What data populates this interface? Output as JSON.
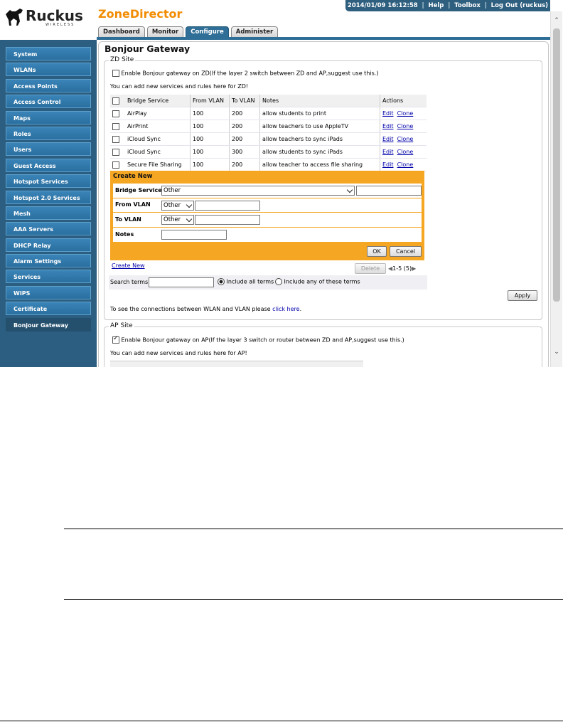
{
  "header": {
    "brand": "Ruckus",
    "brand_sub": "WIRELESS",
    "app_title": "ZoneDirector",
    "datetime": "2014/01/09  16:12:58",
    "links": [
      "Help",
      "Toolbox",
      "Log Out (ruckus)"
    ]
  },
  "tabs": [
    "Dashboard",
    "Monitor",
    "Configure",
    "Administer"
  ],
  "active_tab": "Configure",
  "sidebar": {
    "items": [
      "System",
      "WLANs",
      "Access Points",
      "Access Control",
      "Maps",
      "Roles",
      "Users",
      "Guest Access",
      "Hotspot Services",
      "Hotspot 2.0 Services",
      "Mesh",
      "AAA Servers",
      "DHCP Relay",
      "Alarm Settings",
      "Services",
      "WIPS",
      "Certificate",
      "Bonjour Gateway"
    ],
    "active": "Bonjour Gateway"
  },
  "page_title": "Bonjour Gateway",
  "zd_site": {
    "legend": "ZD Site",
    "enable_label": "Enable Bonjour gateway on ZD(If the layer 2 switch between ZD and AP,suggest use this.)",
    "enabled": false,
    "hint": "You can add new services and rules here for ZD!",
    "columns": [
      "Bridge Service",
      "From VLAN",
      "To VLAN",
      "Notes",
      "Actions"
    ],
    "rows": [
      {
        "service": "AirPlay",
        "from": "100",
        "to": "200",
        "notes": "allow students to print"
      },
      {
        "service": "AirPrint",
        "from": "100",
        "to": "200",
        "notes": "allow teachers to use AppleTV"
      },
      {
        "service": "iCloud Sync",
        "from": "100",
        "to": "200",
        "notes": "allow teachers to sync iPads"
      },
      {
        "service": "iCloud Sync",
        "from": "100",
        "to": "300",
        "notes": "allow students to sync iPads"
      },
      {
        "service": "Secure File Sharing",
        "from": "100",
        "to": "200",
        "notes": "allow teacher to access file sharing"
      }
    ],
    "edit_label": "Edit",
    "clone_label": "Clone",
    "create": {
      "title": "Create New",
      "bridge_label": "Bridge Service",
      "bridge_value": "Other",
      "from_label": "From VLAN",
      "from_value": "Other",
      "to_label": "To VLAN",
      "to_value": "Other",
      "notes_label": "Notes",
      "ok": "OK",
      "cancel": "Cancel"
    },
    "create_new_link": "Create New",
    "delete": "Delete",
    "pager": "1-5 (5)",
    "search_label": "Search terms",
    "search_value": "",
    "opt_all": "Include all terms",
    "opt_any": "Include any of these terms",
    "apply": "Apply",
    "connections_text": "To see the connections between WLAN and VLAN please",
    "connections_link": "click here",
    "connections_end": "."
  },
  "ap_site": {
    "legend": "AP Site",
    "enable_label": "Enable Bonjour gateway on AP(If the layer 3 switch or router between ZD and AP,suggest use this.)",
    "enabled": true,
    "hint": "You can add new services and rules here for AP!"
  }
}
